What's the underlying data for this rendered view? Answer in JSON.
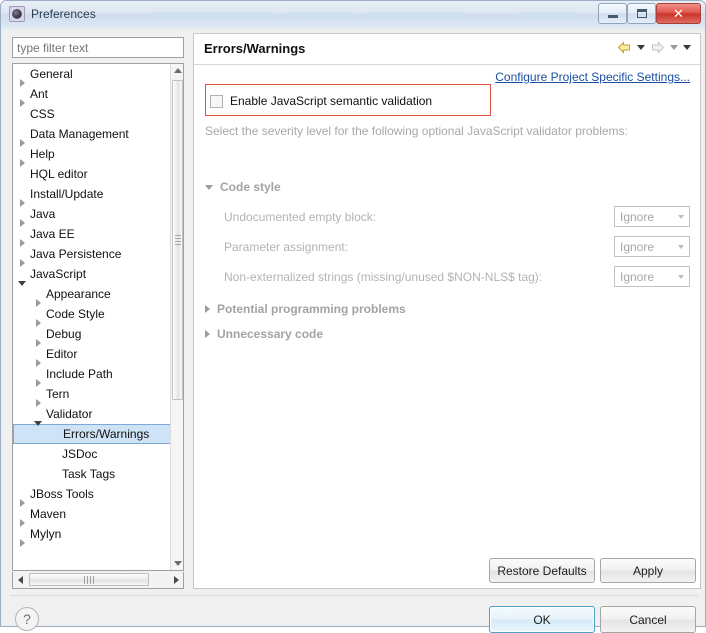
{
  "window": {
    "title": "Preferences",
    "icon": "preferences-gear-icon",
    "buttons": {
      "minimize": "minimize-button",
      "maximize": "maximize-button",
      "close": "✕"
    }
  },
  "sidebar": {
    "filter": {
      "value": "",
      "placeholder": "type filter text"
    },
    "items": [
      {
        "label": "General",
        "indent": 0,
        "state": "collapsed",
        "selected": false
      },
      {
        "label": "Ant",
        "indent": 0,
        "state": "collapsed",
        "selected": false
      },
      {
        "label": "CSS",
        "indent": 0,
        "state": "leaf",
        "selected": false
      },
      {
        "label": "Data Management",
        "indent": 0,
        "state": "collapsed",
        "selected": false
      },
      {
        "label": "Help",
        "indent": 0,
        "state": "collapsed",
        "selected": false
      },
      {
        "label": "HQL editor",
        "indent": 0,
        "state": "leaf",
        "selected": false
      },
      {
        "label": "Install/Update",
        "indent": 0,
        "state": "collapsed",
        "selected": false
      },
      {
        "label": "Java",
        "indent": 0,
        "state": "collapsed",
        "selected": false
      },
      {
        "label": "Java EE",
        "indent": 0,
        "state": "collapsed",
        "selected": false
      },
      {
        "label": "Java Persistence",
        "indent": 0,
        "state": "collapsed",
        "selected": false
      },
      {
        "label": "JavaScript",
        "indent": 0,
        "state": "expanded",
        "selected": false
      },
      {
        "label": "Appearance",
        "indent": 1,
        "state": "collapsed",
        "selected": false
      },
      {
        "label": "Code Style",
        "indent": 1,
        "state": "collapsed",
        "selected": false
      },
      {
        "label": "Debug",
        "indent": 1,
        "state": "collapsed",
        "selected": false
      },
      {
        "label": "Editor",
        "indent": 1,
        "state": "collapsed",
        "selected": false
      },
      {
        "label": "Include Path",
        "indent": 1,
        "state": "collapsed",
        "selected": false
      },
      {
        "label": "Tern",
        "indent": 1,
        "state": "collapsed",
        "selected": false
      },
      {
        "label": "Validator",
        "indent": 1,
        "state": "expanded",
        "selected": false
      },
      {
        "label": "Errors/Warnings",
        "indent": 2,
        "state": "leaf",
        "selected": true
      },
      {
        "label": "JSDoc",
        "indent": 2,
        "state": "leaf",
        "selected": false
      },
      {
        "label": "Task Tags",
        "indent": 2,
        "state": "leaf",
        "selected": false
      },
      {
        "label": "JBoss Tools",
        "indent": 0,
        "state": "collapsed",
        "selected": false
      },
      {
        "label": "Maven",
        "indent": 0,
        "state": "collapsed",
        "selected": false
      },
      {
        "label": "Mylyn",
        "indent": 0,
        "state": "collapsed",
        "selected": false
      }
    ]
  },
  "page": {
    "title": "Errors/Warnings",
    "nav": {
      "back_icon": "back-arrow-icon",
      "back_menu_icon": "chevron-down-icon",
      "forward_icon": "forward-arrow-icon",
      "forward_menu_icon": "chevron-down-icon",
      "view_menu_icon": "chevron-down-icon"
    },
    "project_link": "Configure Project Specific Settings...",
    "enable_checkbox": {
      "label": "Enable JavaScript semantic validation",
      "checked": false
    },
    "description": "Select the severity level for the following optional JavaScript validator problems:",
    "sections": [
      {
        "label": "Code style",
        "expanded": true,
        "options": [
          {
            "label": "Undocumented empty block:",
            "value": "Ignore"
          },
          {
            "label": "Parameter assignment:",
            "value": "Ignore"
          },
          {
            "label": "Non-externalized strings (missing/unused $NON-NLS$ tag):",
            "value": "Ignore"
          }
        ]
      },
      {
        "label": "Potential programming problems",
        "expanded": false,
        "options": []
      },
      {
        "label": "Unnecessary code",
        "expanded": false,
        "options": []
      }
    ],
    "buttons": {
      "restore_defaults": "Restore Defaults",
      "apply": "Apply"
    }
  },
  "footer": {
    "help_icon": "?",
    "ok": "OK",
    "cancel": "Cancel"
  },
  "colors": {
    "highlight_box": "#e0503f",
    "link": "#1a4fa0",
    "selection": "#cfe3f6",
    "close_button": "#c9342a"
  }
}
